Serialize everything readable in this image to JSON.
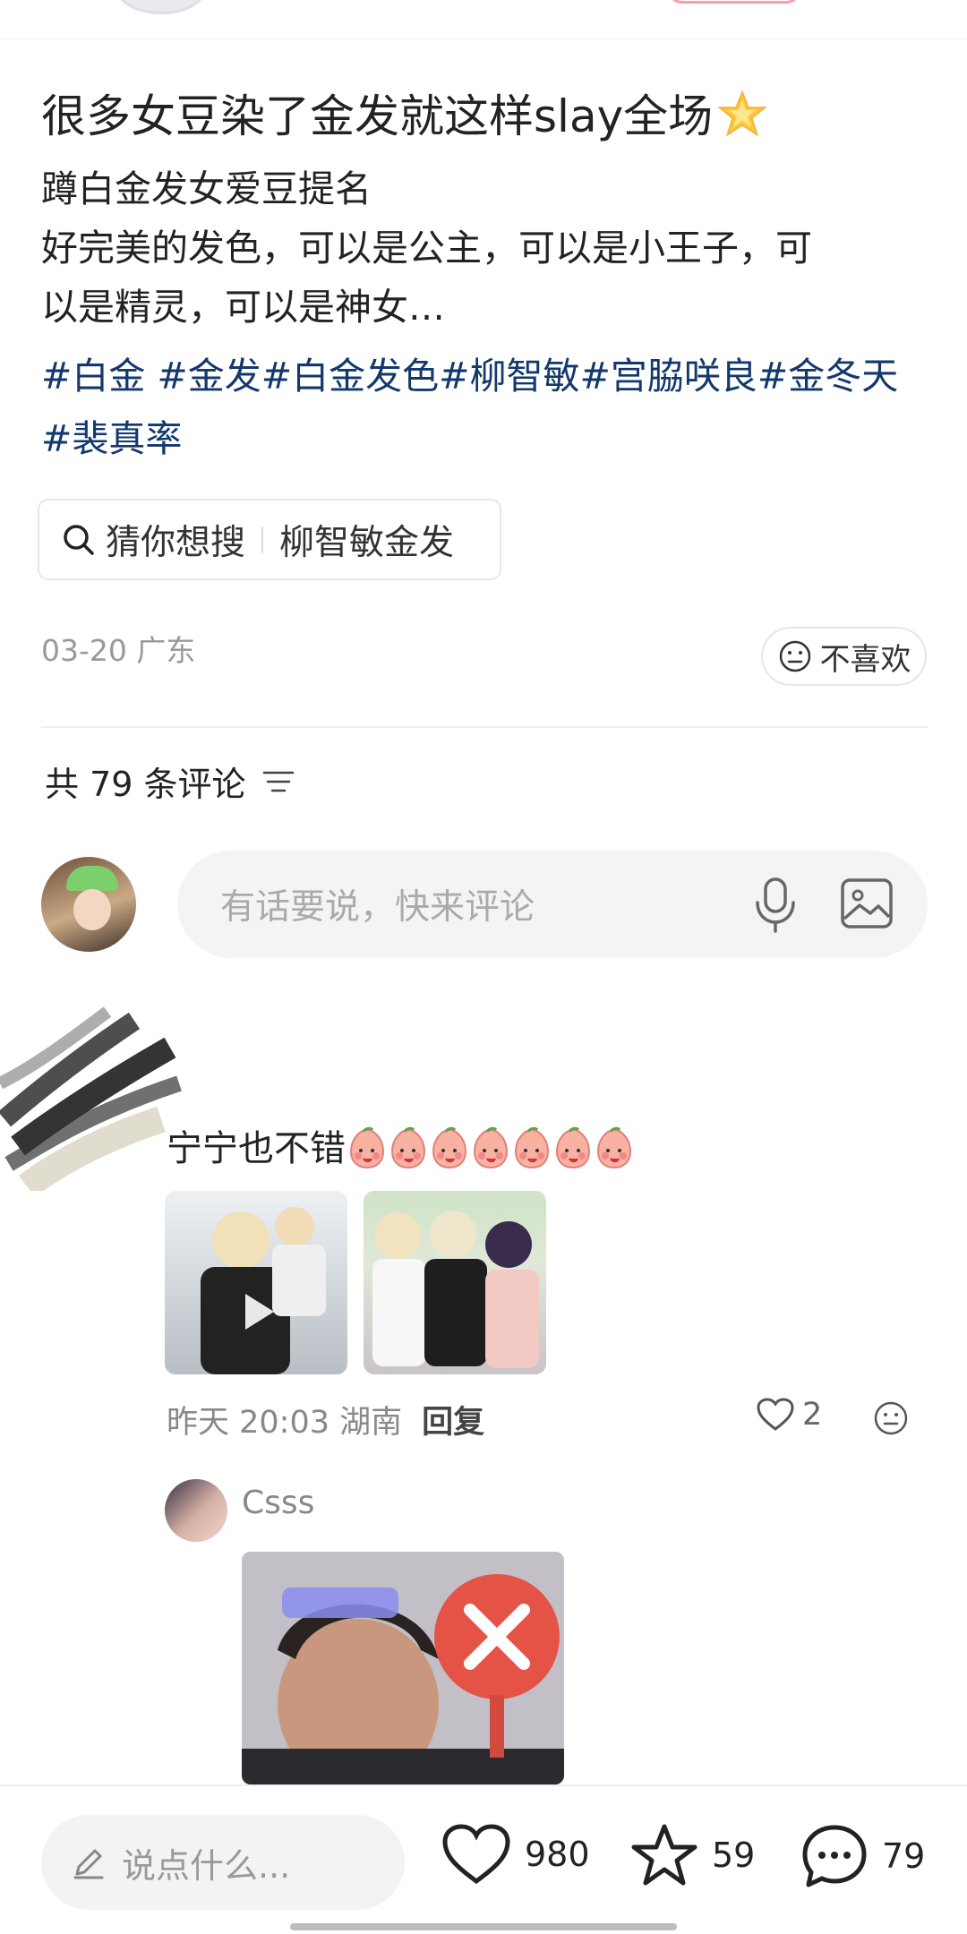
{
  "post": {
    "title": "很多女豆染了金发就这样slay全场",
    "title_emoji": "star-icon",
    "description_lines": [
      "蹲白金发女爱豆提名",
      "好完美的发色，可以是公主，可以是小王子，可",
      "以是精灵，可以是神女…"
    ],
    "tags_line1": [
      "#白金",
      "#金发",
      "#白金发色",
      "#柳智敏",
      "#宫脇咲良",
      "#金冬天"
    ],
    "tags_line2": [
      "#裴真率"
    ],
    "guess_label": "猜你想搜",
    "guess_query": "柳智敏金发",
    "date_location": "03-20 广东",
    "dislike_label": "不喜欢"
  },
  "comments_header": {
    "count_label": "共 79 条评论"
  },
  "comment_input": {
    "placeholder": "有话要说，快来评论"
  },
  "comments": [
    {
      "author": "",
      "text": "宁宁也不错",
      "emoji_count": 7,
      "time_location": "昨天 20:03 湖南",
      "reply_label": "回复",
      "likes": "2"
    },
    {
      "author": "Csss"
    }
  ],
  "bottom_bar": {
    "say_placeholder": "说点什么...",
    "likes": "980",
    "favorites": "59",
    "comments": "79"
  }
}
